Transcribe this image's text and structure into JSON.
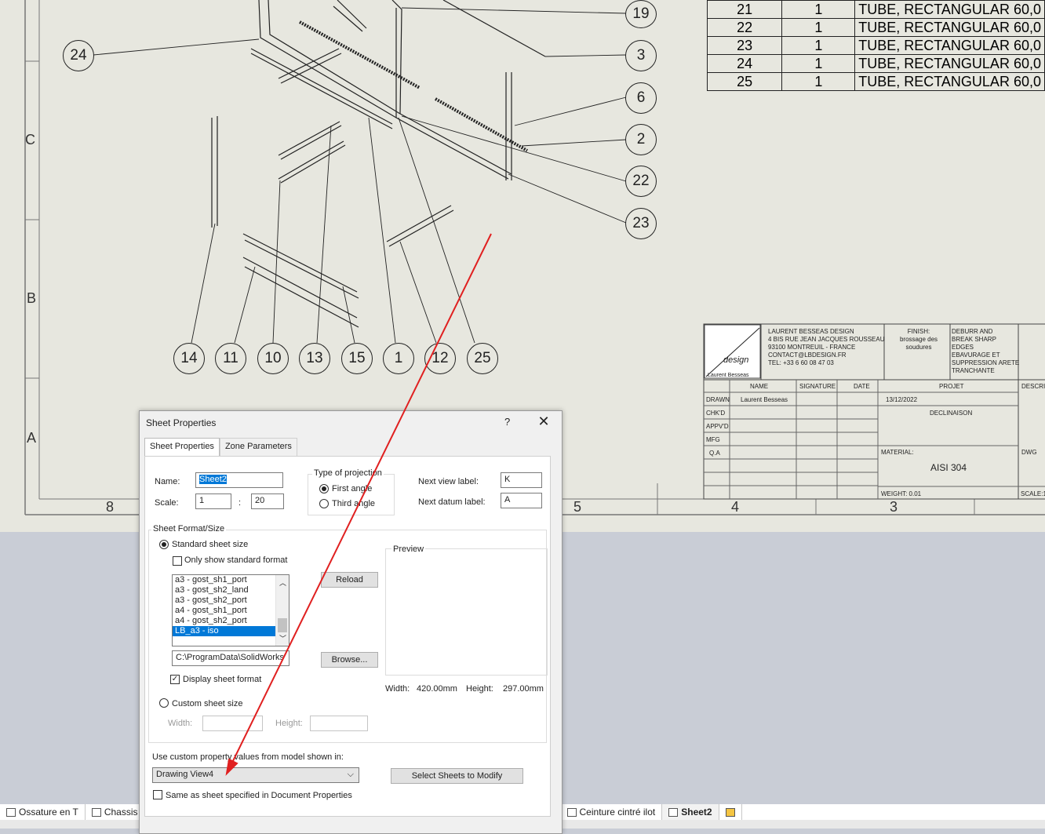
{
  "bom": {
    "rows": [
      {
        "item": "21",
        "qty": "1",
        "desc": "TUBE, RECTANGULAR 60,0"
      },
      {
        "item": "22",
        "qty": "1",
        "desc": "TUBE, RECTANGULAR 60,0"
      },
      {
        "item": "23",
        "qty": "1",
        "desc": "TUBE, RECTANGULAR 60,0"
      },
      {
        "item": "24",
        "qty": "1",
        "desc": "TUBE, RECTANGULAR 60,0"
      },
      {
        "item": "25",
        "qty": "1",
        "desc": "TUBE, RECTANGULAR 60,0"
      }
    ]
  },
  "zones": {
    "c": "C",
    "b": "B",
    "a": "A",
    "n8": "8",
    "n5": "5",
    "n4": "4",
    "n3": "3"
  },
  "balloons": {
    "b19": "19",
    "b24": "24",
    "b3": "3",
    "b6": "6",
    "b2": "2",
    "b22": "22",
    "b23": "23",
    "b14": "14",
    "b11": "11",
    "b10": "10",
    "b13": "13",
    "b15": "15",
    "b1": "1",
    "b12": "12",
    "b25": "25"
  },
  "titleblock": {
    "company_lines": [
      "LAURENT BESSEAS DESIGN",
      "4 BIS RUE JEAN JACQUES ROUSSEAU",
      "93100 MONTREUIL - FRANCE",
      "CONTACT@LBDESIGN.FR",
      "TEL: +33 6 60 08 47 03"
    ],
    "finish_label": "FINISH:",
    "finish_value": "brossage des soudures",
    "deburr": [
      "DEBURR AND",
      "BREAK SHARP",
      "EDGES",
      "EBAVURAGE ET",
      "SUPPRESSION ARETE",
      "TRANCHANTE"
    ],
    "logo_text": "design",
    "logo_sub": "Laurent Besseas",
    "col_name": "NAME",
    "col_signature": "SIGNATURE",
    "col_date": "DATE",
    "col_projet": "PROJET",
    "col_descr": "DESCRIP",
    "drawn_label": "DRAWN",
    "drawn_name": "Laurent Besseas",
    "date_value": "13/12/2022",
    "projet_value": "DECLINAISON",
    "chkd_label": "CHK'D",
    "appvd_label": "APPV'D",
    "mfg_label": "MFG",
    "qa_label": "Q.A",
    "material_label": "MATERIAL:",
    "material_value": "AISI 304",
    "dwg_label": "DWG",
    "weight_label": "WEIGHT: 0.01",
    "scale_label": "SCALE:1"
  },
  "dialog": {
    "title": "Sheet Properties",
    "help": "?",
    "close": "✕",
    "tabs": [
      "Sheet Properties",
      "Zone Parameters"
    ],
    "name_label": "Name:",
    "name_value": "Sheet2",
    "scale_label": "Scale:",
    "scale_num": "1",
    "scale_sep": ":",
    "scale_den": "20",
    "projection_title": "Type of projection",
    "first_angle": "First angle",
    "third_angle": "Third angle",
    "next_view_label": "Next view label:",
    "next_view_value": "K",
    "next_datum_label": "Next datum label:",
    "next_datum_value": "A",
    "format_title": "Sheet Format/Size",
    "standard_size": "Standard sheet size",
    "only_standard": "Only show standard format",
    "formats": [
      "a3 - gost_sh1_port",
      "a3 - gost_sh2_land",
      "a3 - gost_sh2_port",
      "a4 - gost_sh1_port",
      "a4 - gost_sh2_port",
      "LB_a3 - iso"
    ],
    "selected_format": "LB_a3 - iso",
    "reload": "Reload",
    "path_value": "C:\\ProgramData\\SolidWorks",
    "browse": "Browse...",
    "display_format": "Display sheet format",
    "preview_title": "Preview",
    "width_label": "Width:",
    "width_value": "420.00mm",
    "height_label": "Height:",
    "height_value": "297.00mm",
    "custom_size": "Custom sheet size",
    "custom_width": "Width:",
    "custom_height": "Height:",
    "custom_prop_label": "Use custom property values from model shown in:",
    "custom_prop_value": "Drawing View4",
    "select_sheets": "Select Sheets to Modify",
    "same_as": "Same as sheet specified in Document Properties"
  },
  "tabs": {
    "t1": "Ossature en T",
    "t2": "Chassis",
    "t3": "Ceinture cintré ilot",
    "t4": "Sheet2"
  },
  "colors": {
    "accent": "#0078d7",
    "annotation_arrow": "#e02020"
  }
}
